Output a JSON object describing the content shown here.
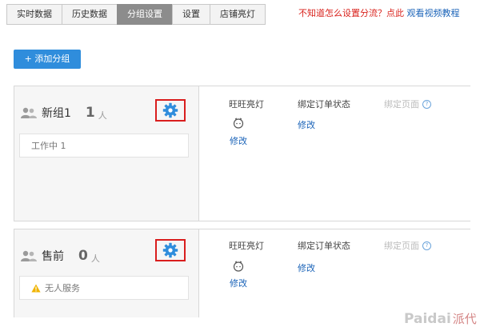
{
  "tabs": [
    {
      "label": "实时数据",
      "active": false
    },
    {
      "label": "历史数据",
      "active": false
    },
    {
      "label": "分组设置",
      "active": true
    },
    {
      "label": "设置",
      "active": false
    },
    {
      "label": "店铺亮灯",
      "active": false
    }
  ],
  "help": {
    "question": "不知道怎么设置分流？点此",
    "link": "观看视频教程"
  },
  "add_group_button": "+ 添加分组",
  "columns": {
    "wangwang": "旺旺亮灯",
    "order_status": "绑定订单状态",
    "page": "绑定页面"
  },
  "edit_label": "修改",
  "groups": [
    {
      "name": "新组1",
      "count": "1",
      "unit": "人",
      "status": "工作中  1",
      "warning": false
    },
    {
      "name": "售前",
      "count": "0",
      "unit": "人",
      "status": "无人服务",
      "warning": true
    }
  ],
  "watermark": {
    "text": "Paidai",
    "cn": "派代"
  },
  "colors": {
    "accent_blue": "#2f8ddc",
    "link_blue": "#1a63b8",
    "highlight_red": "#d91e1e",
    "warning_yellow": "#f0b400"
  }
}
